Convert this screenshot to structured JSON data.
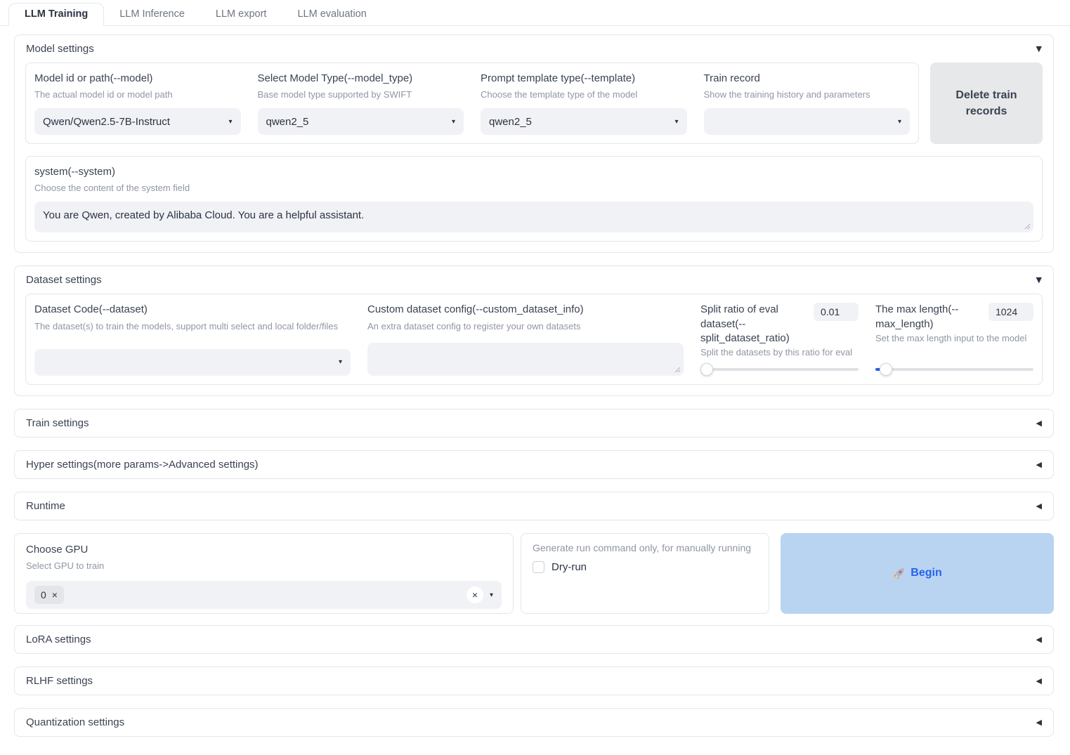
{
  "tabs": [
    {
      "label": "LLM Training"
    },
    {
      "label": "LLM Inference"
    },
    {
      "label": "LLM export"
    },
    {
      "label": "LLM evaluation"
    }
  ],
  "model_settings": {
    "title": "Model settings",
    "model": {
      "label": "Model id or path(--model)",
      "info": "The actual model id or model path",
      "value": "Qwen/Qwen2.5-7B-Instruct"
    },
    "model_type": {
      "label": "Select Model Type(--model_type)",
      "info": "Base model type supported by SWIFT",
      "value": "qwen2_5"
    },
    "template": {
      "label": "Prompt template type(--template)",
      "info": "Choose the template type of the model",
      "value": "qwen2_5"
    },
    "train_record": {
      "label": "Train record",
      "info": "Show the training history and parameters",
      "value": ""
    },
    "delete_button": "Delete train records",
    "system": {
      "label": "system(--system)",
      "info": "Choose the content of the system field",
      "value": "You are Qwen, created by Alibaba Cloud. You are a helpful assistant."
    }
  },
  "dataset_settings": {
    "title": "Dataset settings",
    "dataset": {
      "label": "Dataset Code(--dataset)",
      "info": "The dataset(s) to train the models, support multi select and local folder/files",
      "value": ""
    },
    "custom": {
      "label": "Custom dataset config(--custom_dataset_info)",
      "info": "An extra dataset config to register your own datasets",
      "value": ""
    },
    "split": {
      "label": "Split ratio of eval dataset(--split_dataset_ratio)",
      "info": "Split the datasets by this ratio for eval",
      "value": "0.01"
    },
    "maxlen": {
      "label": "The max length(--max_length)",
      "info": "Set the max length input to the model",
      "value": "1024"
    }
  },
  "accordions": {
    "train": "Train settings",
    "hyper": "Hyper settings(more params->Advanced settings)",
    "runtime": "Runtime",
    "lora": "LoRA settings",
    "rlhf": "RLHF settings",
    "quant": "Quantization settings"
  },
  "gpu": {
    "label": "Choose GPU",
    "info": "Select GPU to train",
    "selected_chip": "0"
  },
  "run": {
    "generate_label": "Generate run command only, for manually running",
    "dryrun_label": "Dry-run",
    "dryrun_checked": false,
    "begin_label": "Begin"
  },
  "icons": {
    "expanded": "▼",
    "collapsed": "◀",
    "dropdown": "▾",
    "close": "×"
  },
  "colors": {
    "begin_bg": "#b9d4f1",
    "begin_text": "#2563eb",
    "slider_fill": "#2563eb"
  }
}
